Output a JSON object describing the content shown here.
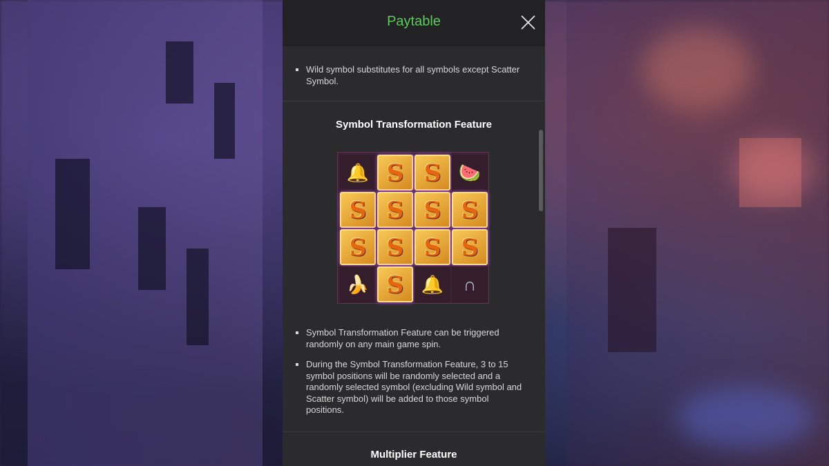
{
  "header": {
    "title": "Paytable",
    "close_icon": "close-icon"
  },
  "wild_section": {
    "bullets": [
      "Wild symbol substitutes for all symbols except Scatter Symbol."
    ]
  },
  "symbol_transformation": {
    "title": "Symbol Transformation Feature",
    "illustration": {
      "rows": [
        [
          "bell",
          "wild",
          "wild",
          "watermelon"
        ],
        [
          "wild",
          "wild",
          "wild",
          "wild"
        ],
        [
          "wild",
          "wild",
          "wild",
          "wild"
        ],
        [
          "banana",
          "wild",
          "bell",
          "horseshoe"
        ]
      ],
      "wild_glyph": "S"
    },
    "bullets": [
      "Symbol Transformation Feature can be triggered randomly on any main game spin.",
      "During the Symbol Transformation Feature, 3 to 15 symbol positions will be randomly selected and a randomly selected symbol (excluding Wild symbol and Scatter symbol) will be added to those symbol positions."
    ]
  },
  "multiplier": {
    "title": "Multiplier Feature"
  },
  "colors": {
    "title_green": "#5cc95f",
    "panel_bg": "#2b2b2e",
    "header_bg": "#222224"
  }
}
